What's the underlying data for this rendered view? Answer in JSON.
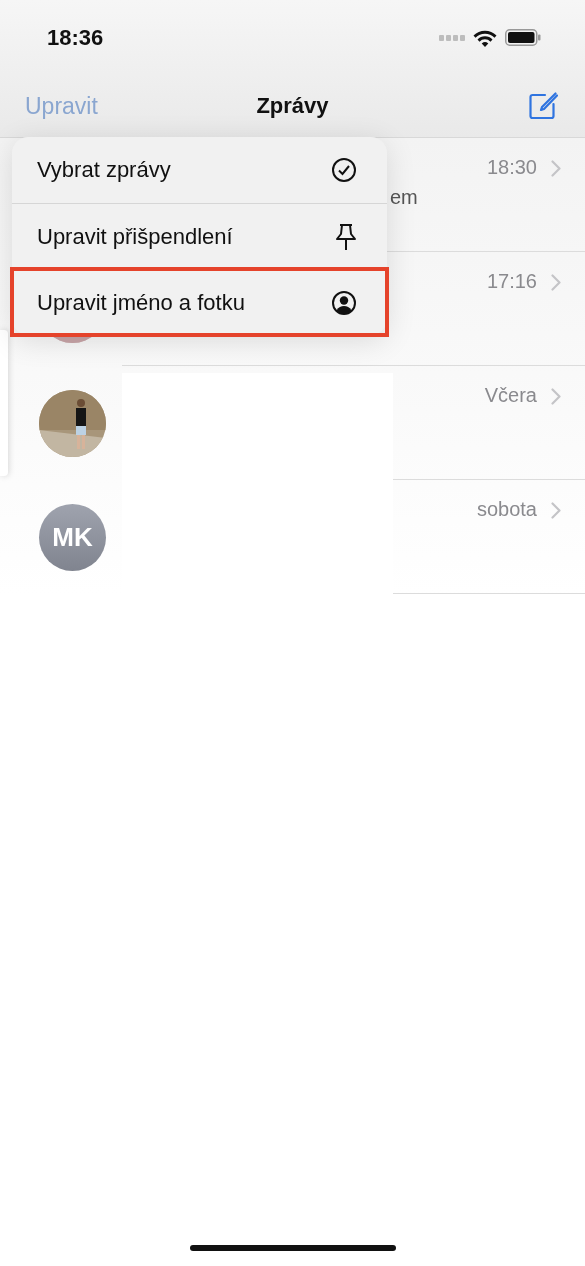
{
  "status_bar": {
    "time": "18:36"
  },
  "nav_bar": {
    "edit_button": {
      "label": "Upravit",
      "disabled": true
    },
    "title": "Zprávy"
  },
  "conversations": [
    {
      "time": "18:30",
      "preview": "em"
    },
    {
      "time": "17:16"
    },
    {
      "time": "Včera"
    },
    {
      "time": "sobota",
      "avatar": {
        "kind": "initials",
        "initials": "MK"
      }
    }
  ],
  "context_menu": {
    "items": [
      {
        "label": "Vybrat zprávy",
        "highlighted": false
      },
      {
        "label": "Upravit přišpendlení",
        "highlighted": false
      },
      {
        "label": "Upravit jméno a fotku",
        "highlighted": true
      }
    ]
  }
}
